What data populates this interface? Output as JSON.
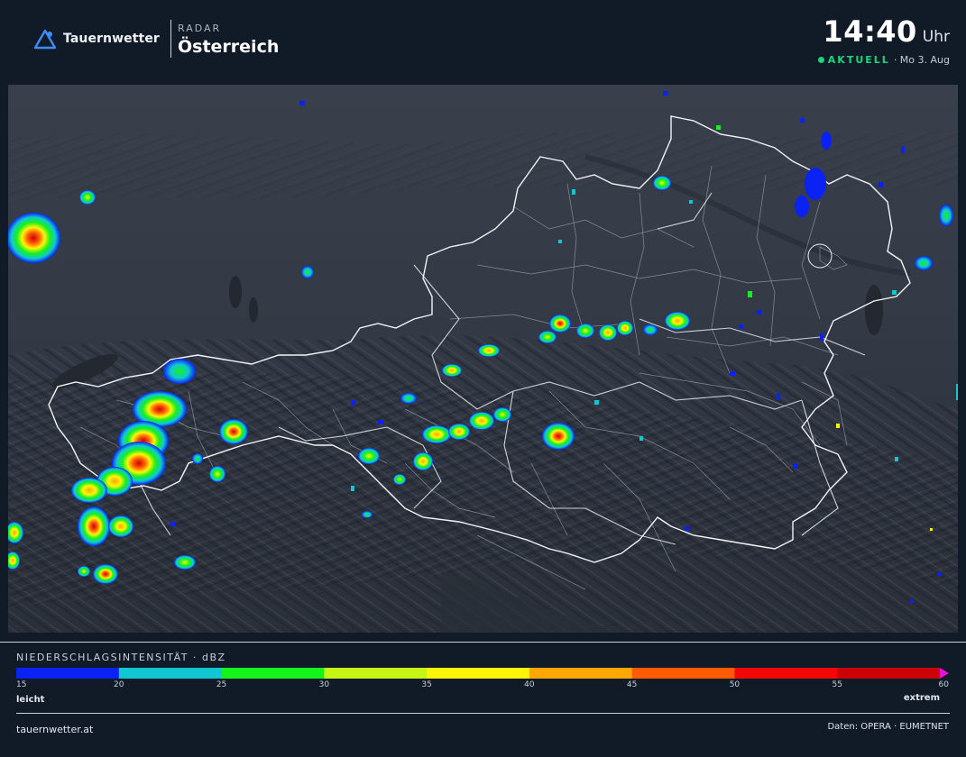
{
  "header": {
    "brand_name": "Tauernwetter",
    "brand_icon": "mountain-triangle-icon",
    "section_kicker": "RADAR",
    "section_title": "Österreich",
    "time": "14:40",
    "time_unit": "Uhr",
    "status_label": "AKTUELL",
    "date": "· Mo 3. Aug"
  },
  "colors": {
    "background": "#111a27",
    "map_background": "#2f3541",
    "live_accent": "#1fd27c",
    "border_line": "#ffffff",
    "brand_blue": "#3d8cff"
  },
  "map": {
    "region": "Österreich",
    "layers": [
      "shaded-relief",
      "state-borders",
      "district-borders",
      "radar-echoes"
    ]
  },
  "legend": {
    "title": "NIEDERSCHLAGSINTENSITÄT · dBZ",
    "min_label": "leicht",
    "max_label": "extrem",
    "ticks": [
      "15",
      "20",
      "25",
      "30",
      "35",
      "40",
      "45",
      "50",
      "55",
      "60"
    ],
    "bands": [
      {
        "from": 15,
        "to": 20,
        "color": "#0a22f4"
      },
      {
        "from": 20,
        "to": 25,
        "color": "#12c7d2"
      },
      {
        "from": 25,
        "to": 30,
        "color": "#15f21c"
      },
      {
        "from": 30,
        "to": 35,
        "color": "#c6f515"
      },
      {
        "from": 35,
        "to": 40,
        "color": "#fdf509"
      },
      {
        "from": 40,
        "to": 45,
        "color": "#ffa707"
      },
      {
        "from": 45,
        "to": 50,
        "color": "#ff5a04"
      },
      {
        "from": 50,
        "to": 55,
        "color": "#f30808"
      },
      {
        "from": 55,
        "to": 60,
        "color": "#cc0306"
      }
    ],
    "overflow_color": "#e610d6"
  },
  "footer": {
    "site": "tauernwetter.at",
    "credit": "Daten: OPERA · EUMETNET"
  }
}
